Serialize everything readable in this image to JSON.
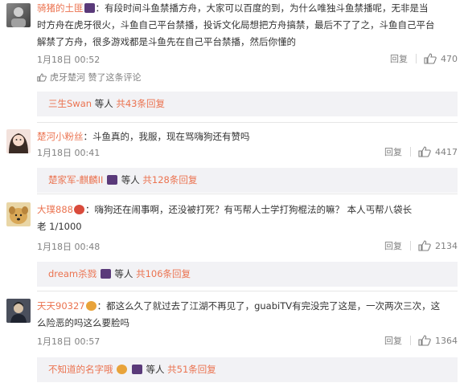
{
  "comments": [
    {
      "username": "骑猪的土匪",
      "text_line1": "：有段时间斗鱼禁播方舟，大家可以百度的到，为什么唯独斗鱼禁播呢，无非是当",
      "text_line2": "时方舟在虎牙很火，斗鱼自己平台禁播，投诉文化局想把方舟搞禁，最后不了了之，斗鱼自己平台",
      "text_line3": "解禁了方舟，很多游戏都是斗鱼先在自己平台禁播，然后你懂的",
      "time": "1月18日 00:52",
      "reply_label": "回复",
      "likes": "470",
      "liked_by": "虎牙楚河 赞了这条评论",
      "sub_user": "三生Swan",
      "sub_suffix": "等人",
      "sub_count": "共43条回复"
    },
    {
      "username": "楚河小粉丝",
      "text_line1": "：斗鱼真的，我服，现在骂嗨狗还有赞吗",
      "time": "1月18日 00:41",
      "reply_label": "回复",
      "likes": "4417",
      "sub_user": "楚家军-麒麟II",
      "sub_suffix": "等人",
      "sub_count": "共128条回复"
    },
    {
      "username": "大璞888",
      "text_line1": "：嗨狗还在闹事啊，还没被打死？有丐帮人士学打狗棍法的嘛？ 本人丐帮八袋长",
      "text_line2": "老 1/1000",
      "time": "1月18日 00:48",
      "reply_label": "回复",
      "likes": "2134",
      "sub_user": "dream杀戮",
      "sub_suffix": "等人",
      "sub_count": "共106条回复"
    },
    {
      "username": "天天90327",
      "text_line1": "：都这么久了就过去了江湖不再见了，guabiTV有完没完了这是，一次两次三次，这",
      "text_line2": "么险恶的吗这么要脸吗",
      "time": "1月18日 00:57",
      "reply_label": "回复",
      "likes": "1364",
      "sub_user": "不知道的名字哦",
      "sub_suffix": "等人",
      "sub_count": "共51条回复"
    }
  ],
  "icons": {
    "thumb": "thumbs-up-icon",
    "vip": "vip-badge-icon",
    "like_small": "thumbs-up-small-icon"
  },
  "colors": {
    "link": "#eb7350",
    "muted": "#808080",
    "subreply_bg": "#f2f2f5"
  }
}
